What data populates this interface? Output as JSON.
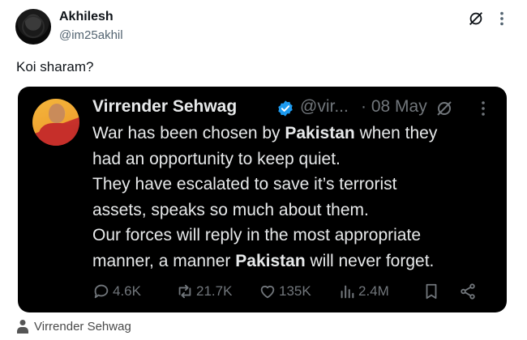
{
  "post": {
    "author_name": "Akhilesh",
    "author_handle": "@im25akhil",
    "text": "Koi sharam?"
  },
  "embedded_post": {
    "author_name": "Virrender Sehwag",
    "author_handle": "@vir...",
    "date": "· 08 May",
    "lines": [
      {
        "pre": "War has been chosen by ",
        "bold": "Pakistan",
        "post": " when they"
      },
      {
        "pre": "had an opportunity to keep quiet.",
        "bold": "",
        "post": ""
      },
      {
        "pre": "They have escalated to save it’s terrorist",
        "bold": "",
        "post": ""
      },
      {
        "pre": "assets, speaks so much about them.",
        "bold": "",
        "post": ""
      },
      {
        "pre": "Our forces will reply in the most appropriate",
        "bold": "",
        "post": ""
      },
      {
        "pre": "manner, a manner ",
        "bold": "Pakistan",
        "post": " will never forget."
      }
    ],
    "metrics": {
      "replies": "4.6K",
      "reposts": "21.7K",
      "likes": "135K",
      "views": "2.4M"
    },
    "icons": [
      "verified-badge-icon",
      "grok-icon",
      "more-icon",
      "reply-icon",
      "repost-icon",
      "like-icon",
      "views-icon",
      "bookmark-icon",
      "share-icon"
    ]
  },
  "caption": {
    "text": "Virrender Sehwag",
    "icon": "person-icon"
  },
  "colors": {
    "verified": "#1d9bf0",
    "embed_background": "#000000",
    "secondary_text": "#71767b"
  }
}
